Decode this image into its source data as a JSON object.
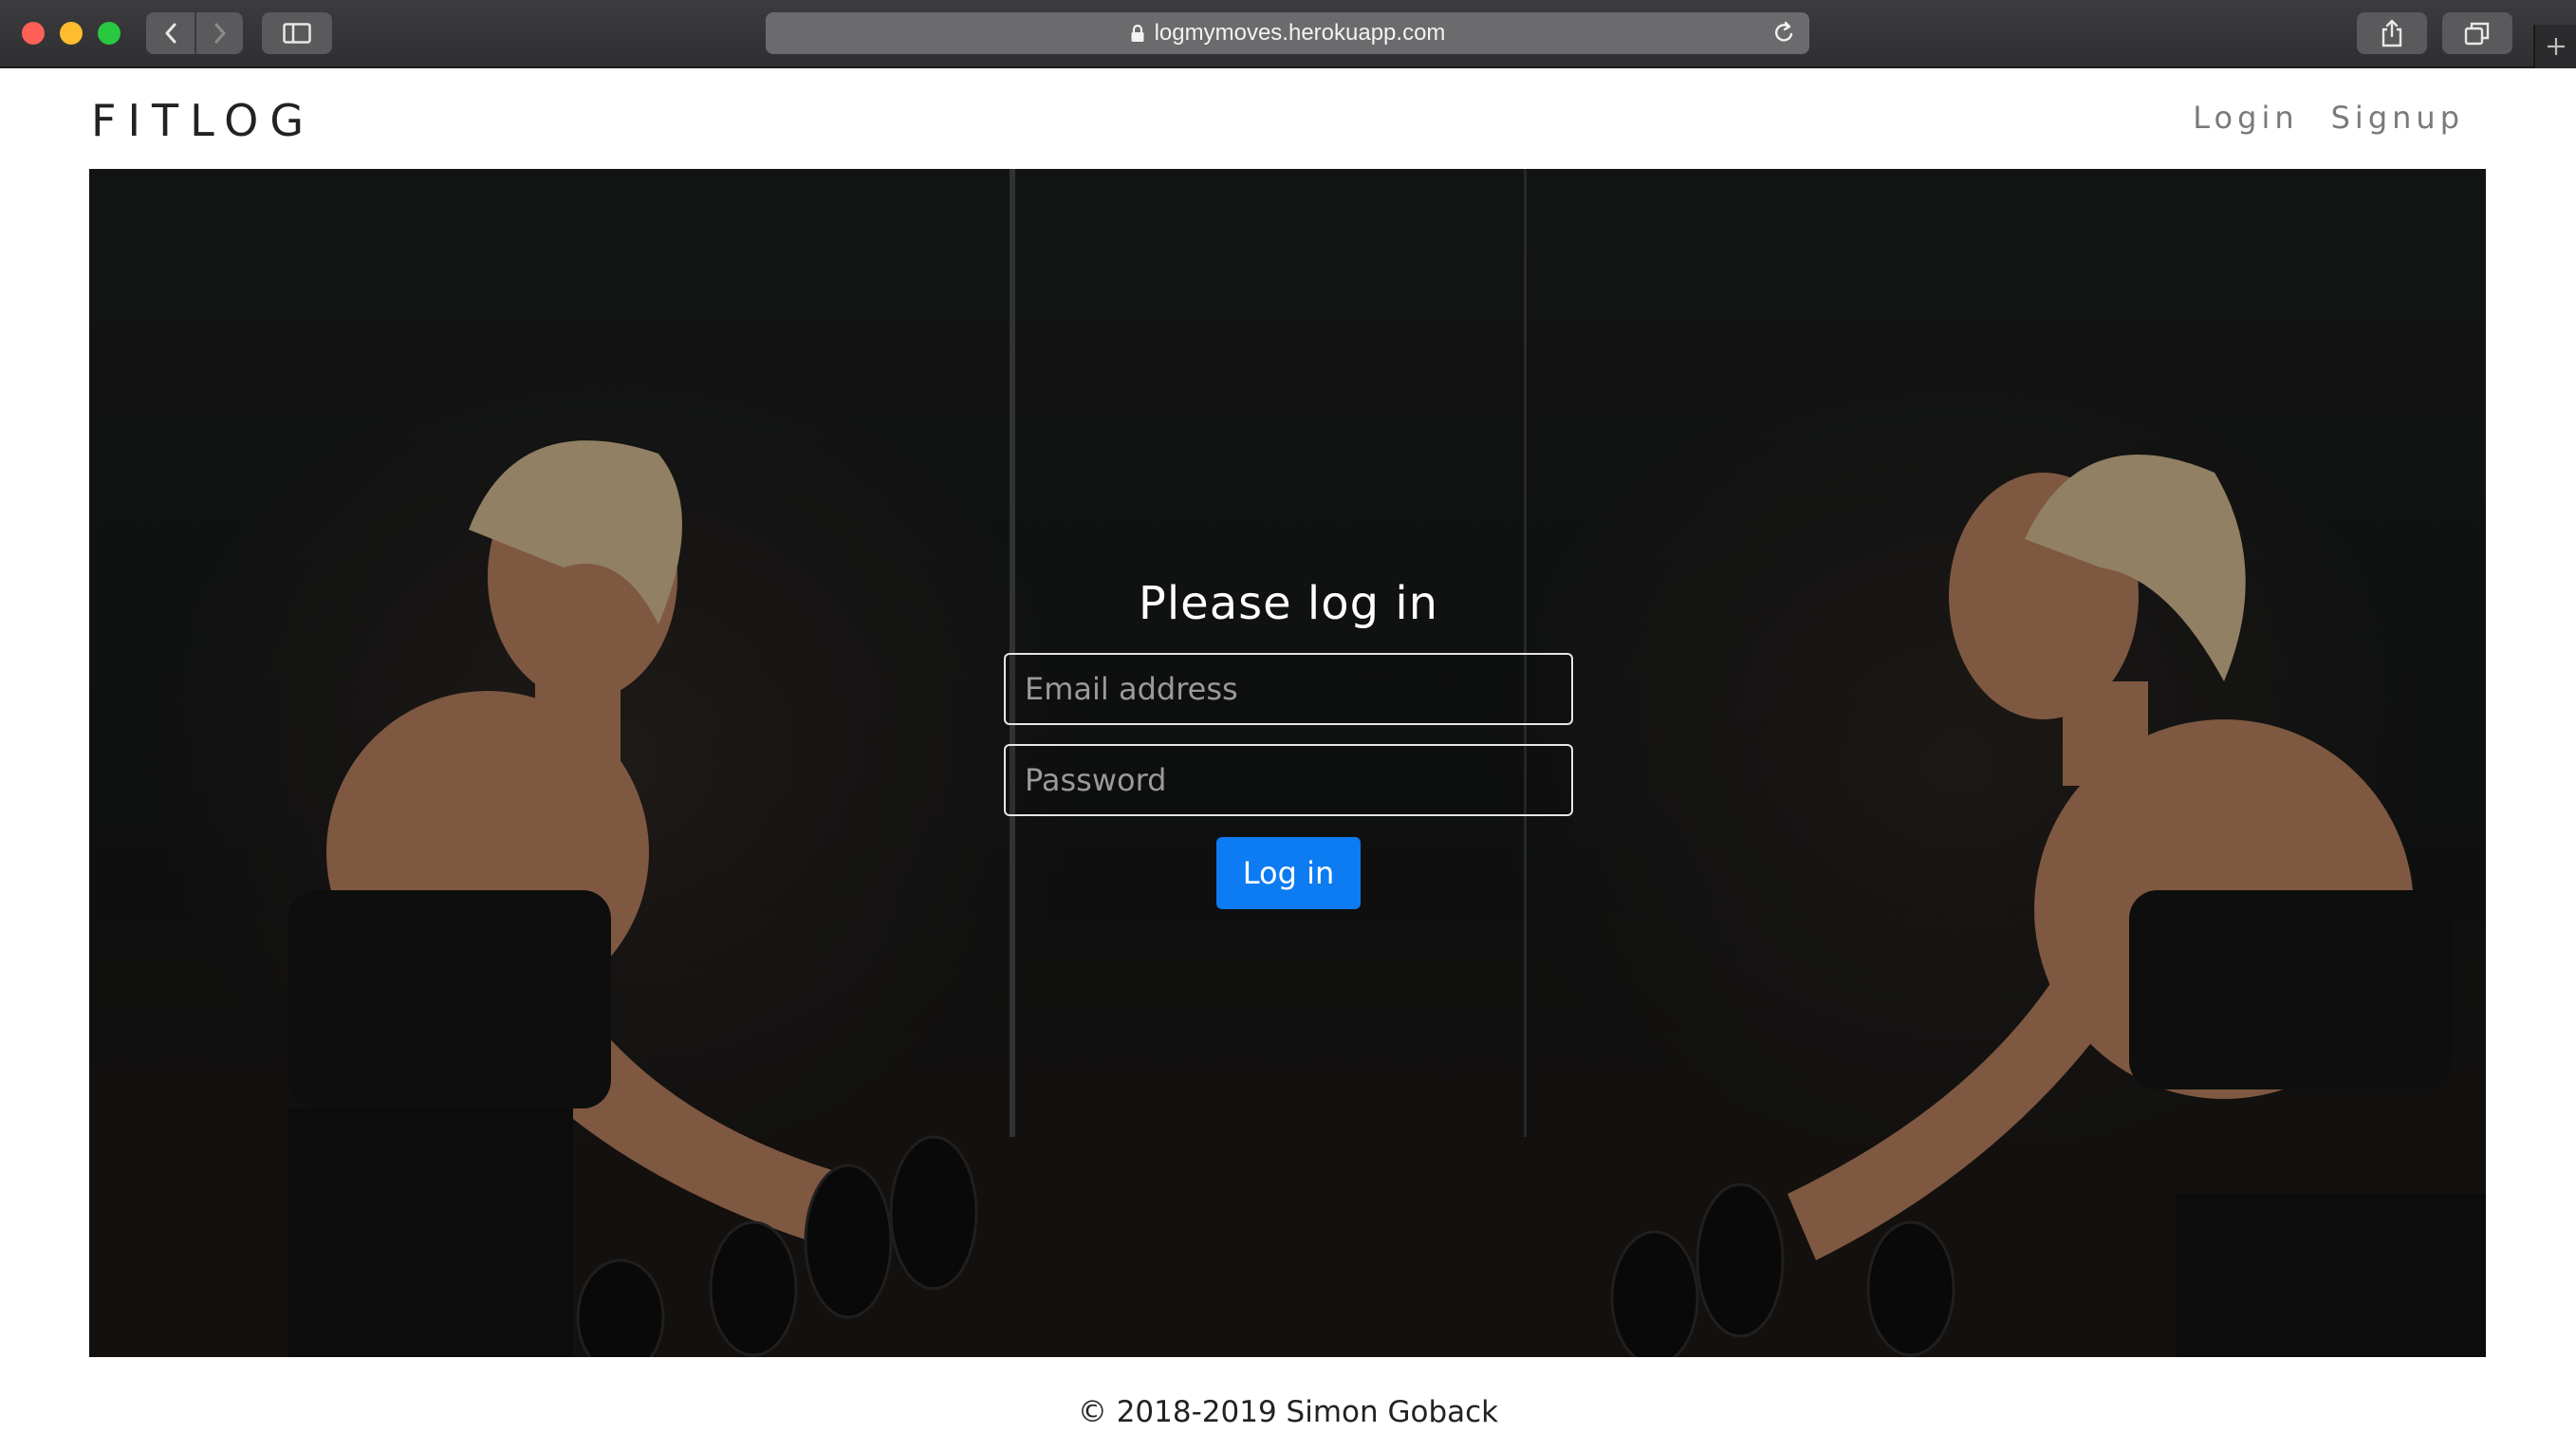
{
  "browser": {
    "url": "logmymoves.herokuapp.com",
    "icons": {
      "back": "chevron-left-icon",
      "forward": "chevron-right-icon",
      "sidebar": "sidebar-icon",
      "lock": "lock-icon",
      "reload": "reload-icon",
      "share": "share-icon",
      "tabs": "tabs-overview-icon",
      "new_tab": "plus-icon"
    }
  },
  "site": {
    "brand": "FITLOG",
    "nav": [
      {
        "label": "Login"
      },
      {
        "label": "Signup"
      }
    ]
  },
  "hero": {
    "image": "photo of a woman lifting dumbbells facing a gym mirror",
    "login": {
      "title": "Please log in",
      "email_placeholder": "Email address",
      "password_placeholder": "Password",
      "submit_label": "Log in"
    }
  },
  "footer": {
    "copyright": "© 2018-2019 Simon Goback"
  },
  "colors": {
    "primary": "#0d7bf2",
    "hero_background": "#171818"
  }
}
